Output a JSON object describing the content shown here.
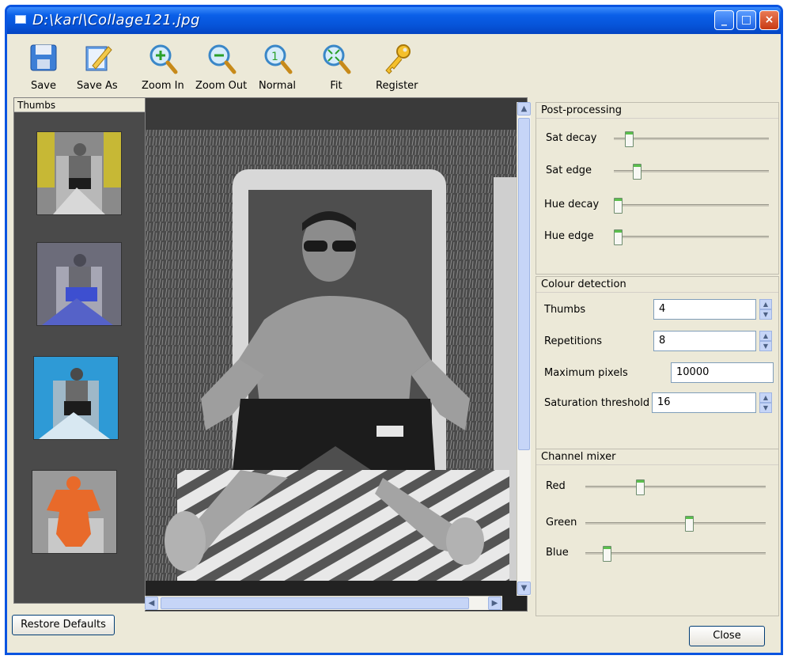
{
  "window": {
    "title": "D:\\karl\\Collage121.jpg",
    "controls": {
      "minimize": "_",
      "maximize": "□",
      "close": "×"
    }
  },
  "toolbar": {
    "items": [
      {
        "label": "Save",
        "icon": "floppy-disk-icon"
      },
      {
        "label": "Save As",
        "icon": "edit-document-icon"
      },
      {
        "label": "Zoom In",
        "icon": "zoom-in-icon"
      },
      {
        "label": "Zoom Out",
        "icon": "zoom-out-icon"
      },
      {
        "label": "Normal",
        "icon": "zoom-normal-icon"
      },
      {
        "label": "Fit",
        "icon": "zoom-fit-icon"
      },
      {
        "label": "Register",
        "icon": "key-icon"
      }
    ]
  },
  "thumbs": {
    "header": "Thumbs",
    "items": [
      {
        "tint": "#c7b835"
      },
      {
        "tint": "#3d4fd0"
      },
      {
        "tint": "#2e9ad6"
      },
      {
        "tint": "#e86a2a"
      }
    ]
  },
  "post_processing": {
    "title": "Post-processing",
    "sliders": [
      {
        "label": "Sat decay",
        "value": 0.08
      },
      {
        "label": "Sat edge",
        "value": 0.13
      },
      {
        "label": "Hue decay",
        "value": 0.0
      },
      {
        "label": "Hue edge",
        "value": 0.0
      }
    ]
  },
  "colour_detection": {
    "title": "Colour detection",
    "fields": [
      {
        "label": "Thumbs",
        "value": "4",
        "spinner": true
      },
      {
        "label": "Repetitions",
        "value": "8",
        "spinner": true
      },
      {
        "label": "Maximum pixels",
        "value": "10000",
        "spinner": false
      },
      {
        "label": "Saturation threshold",
        "value": "16",
        "spinner": true
      }
    ]
  },
  "channel_mixer": {
    "title": "Channel mixer",
    "sliders": [
      {
        "label": "Red",
        "value": 0.31
      },
      {
        "label": "Green",
        "value": 0.58
      },
      {
        "label": "Blue",
        "value": 0.13
      }
    ]
  },
  "buttons": {
    "restore_defaults": "Restore Defaults",
    "close": "Close"
  },
  "colors": {
    "titlebar": "#0653d8",
    "window_bg": "#ece9d8",
    "slider_accent": "#5bbf4c"
  }
}
